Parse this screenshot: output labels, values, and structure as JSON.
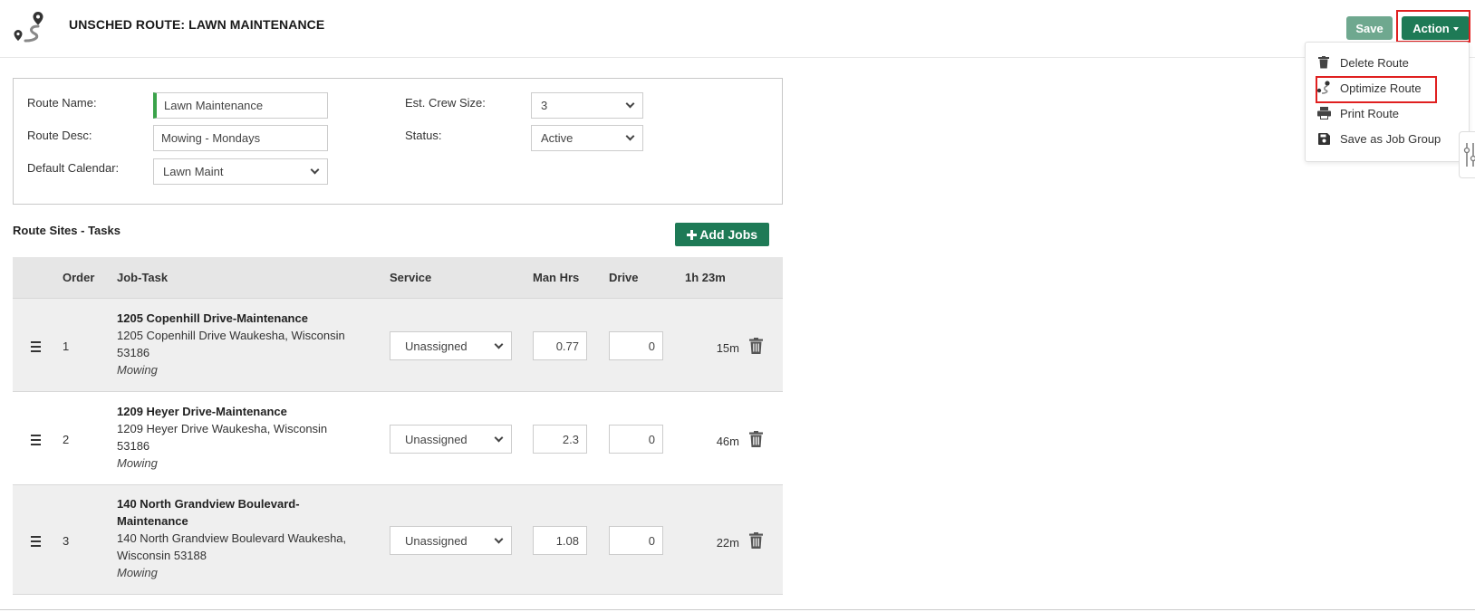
{
  "header": {
    "title": "UNSCHED ROUTE: LAWN MAINTENANCE",
    "save_label": "Save",
    "action_label": "Action"
  },
  "action_menu": {
    "items": [
      {
        "label": "Delete Route",
        "icon": "trash-icon"
      },
      {
        "label": "Optimize Route",
        "icon": "optimize-route-icon"
      },
      {
        "label": "Print Route",
        "icon": "printer-icon"
      },
      {
        "label": "Save as Job Group",
        "icon": "floppy-disk-icon"
      }
    ]
  },
  "form": {
    "route_name_label": "Route Name:",
    "route_name_value": "Lawn Maintenance",
    "route_desc_label": "Route Desc:",
    "route_desc_value": "Mowing - Mondays",
    "default_calendar_label": "Default Calendar:",
    "default_calendar_value": "Lawn Maint",
    "crew_size_label": "Est. Crew Size:",
    "crew_size_value": "3",
    "status_label": "Status:",
    "status_value": "Active"
  },
  "sites": {
    "section_title": "Route Sites - Tasks",
    "add_jobs_label": "Add Jobs",
    "columns": {
      "order": "Order",
      "job_task": "Job-Task",
      "service": "Service",
      "man_hrs": "Man Hrs",
      "drive": "Drive",
      "total": "1h 23m"
    },
    "rows": [
      {
        "order": "1",
        "title": "1205 Copenhill Drive-Maintenance",
        "address": "1205 Copenhill Drive Waukesha, Wisconsin 53186",
        "service_type": "Mowing",
        "service": "Unassigned",
        "man_hrs": "0.77",
        "drive": "0",
        "duration": "15m"
      },
      {
        "order": "2",
        "title": "1209 Heyer Drive-Maintenance",
        "address": "1209 Heyer Drive Waukesha, Wisconsin 53186",
        "service_type": "Mowing",
        "service": "Unassigned",
        "man_hrs": "2.3",
        "drive": "0",
        "duration": "46m"
      },
      {
        "order": "3",
        "title": "140 North Grandview Boulevard-Maintenance",
        "address": "140 North Grandview Boulevard Waukesha, Wisconsin 53188",
        "service_type": "Mowing",
        "service": "Unassigned",
        "man_hrs": "1.08",
        "drive": "0",
        "duration": "22m"
      }
    ]
  },
  "colors": {
    "primary_green": "#1e7a56",
    "save_green_disabled": "#6fa88f",
    "required_indicator": "#3aa34a",
    "highlight_red": "#e02020"
  }
}
